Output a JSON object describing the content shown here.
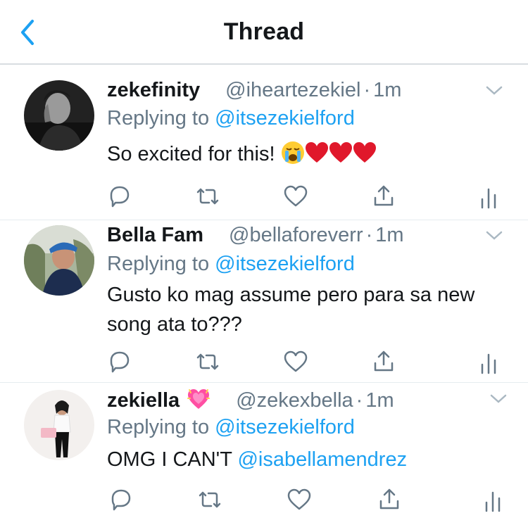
{
  "header": {
    "title": "Thread",
    "back_icon": "chevron-left-icon",
    "accent_color": "#1da1f2"
  },
  "tweets": [
    {
      "name": "zekefinity",
      "handle": "@iheartezekiel",
      "dot": "·",
      "time": "1m",
      "replying_prefix": "Replying to ",
      "replying_to": "@itsezekielford",
      "text": "So excited for this! ",
      "emojis": [
        "loudly-crying-face",
        "red-heart",
        "red-heart",
        "red-heart"
      ]
    },
    {
      "name": "Bella Fam",
      "handle": "@bellaforeverr",
      "dot": "·",
      "time": "1m",
      "replying_prefix": "Replying to ",
      "replying_to": "@itsezekielford",
      "text": "Gusto ko mag assume pero para sa new song ata to???"
    },
    {
      "name": "zekiella",
      "name_badge": "sparkling-heart",
      "handle": "@zekexbella",
      "dot": "·",
      "time": "1m",
      "replying_prefix": "Replying to ",
      "replying_to": "@itsezekielford",
      "text": "OMG I CAN'T ",
      "text_mention": "@isabellamendrez"
    }
  ],
  "actions": [
    "reply-icon",
    "retweet-icon",
    "like-icon",
    "share-icon",
    "analytics-icon"
  ]
}
